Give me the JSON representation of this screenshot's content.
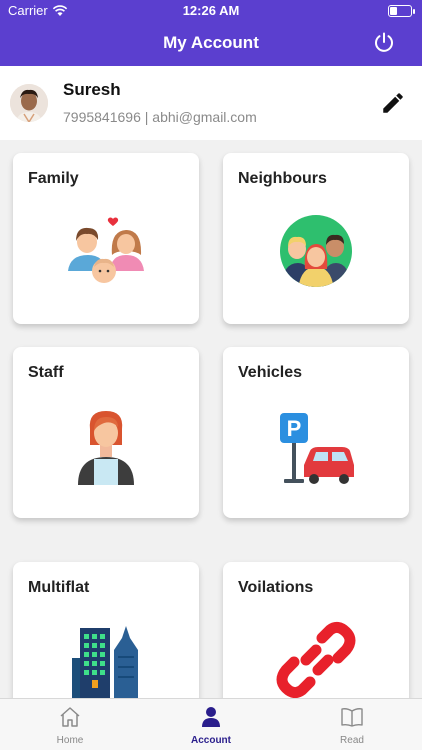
{
  "status_bar": {
    "carrier": "Carrier",
    "time": "12:26 AM",
    "battery_level": 0.35
  },
  "header": {
    "title": "My Account",
    "power_icon": "power-icon"
  },
  "profile": {
    "name": "Suresh",
    "contact": "7995841696 | abhi@gmail.com",
    "edit_icon": "pencil-icon"
  },
  "cards": [
    {
      "label": "Family",
      "icon": "family-icon"
    },
    {
      "label": "Neighbours",
      "icon": "neighbours-icon"
    },
    {
      "label": "Staff",
      "icon": "staff-icon"
    },
    {
      "label": "Vehicles",
      "icon": "vehicle-parking-icon"
    },
    {
      "label": "Multiflat",
      "icon": "building-icon"
    },
    {
      "label": "Voilations",
      "icon": "broken-link-icon"
    }
  ],
  "tabbar": {
    "items": [
      {
        "label": "Home",
        "icon": "home-icon",
        "active": false
      },
      {
        "label": "Account",
        "icon": "person-icon",
        "active": true
      },
      {
        "label": "Read",
        "icon": "book-icon",
        "active": false
      }
    ]
  },
  "colors": {
    "header_bg": "#5b3fcf",
    "active_tab": "#2a1e8c"
  }
}
